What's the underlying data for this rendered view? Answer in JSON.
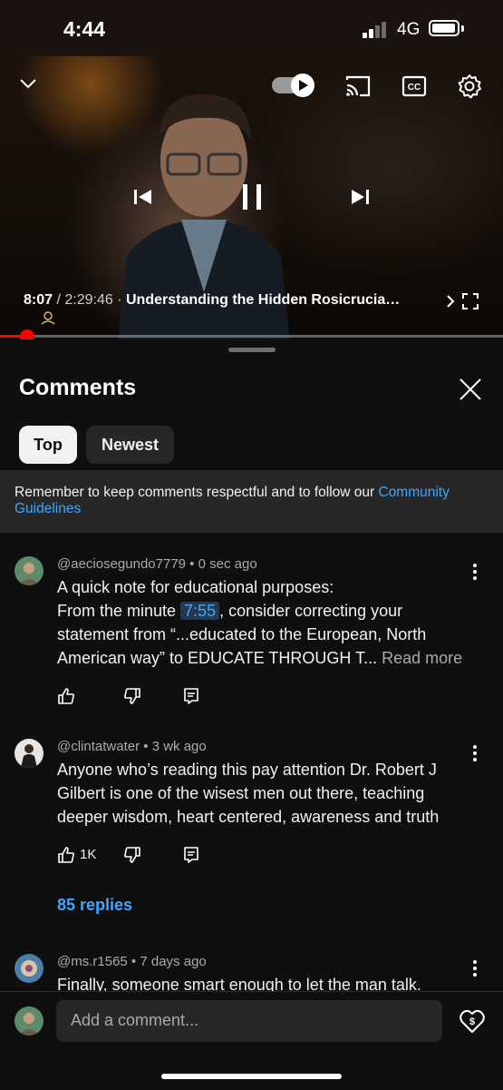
{
  "status_bar": {
    "time": "4:44",
    "network": "4G"
  },
  "video": {
    "current_time": "8:07",
    "duration": "2:29:46",
    "separator": " / ",
    "dot": " · ",
    "title": "Understanding the Hidden Rosicrucia…",
    "progress_fraction": 0.054
  },
  "comments_panel": {
    "title": "Comments",
    "tabs": [
      {
        "label": "Top",
        "selected": true
      },
      {
        "label": "Newest",
        "selected": false
      }
    ],
    "notice_text": "Remember to keep comments respectful and to follow our ",
    "notice_link": "Community Guidelines"
  },
  "comments": [
    {
      "author": "@aeciosegundo7779",
      "age": "0 sec ago",
      "line1": "A quick note for educational purposes:",
      "line2_pre": "From the minute ",
      "timestamp": "7:55",
      "line2_post": ", consider correcting your",
      "line3": "statement from “...educated to the European, North",
      "line4": "American way” to EDUCATE THROUGH T... ",
      "read_more": "Read more"
    },
    {
      "author": "@clintatwater",
      "age": "3 wk ago",
      "line1": "Anyone who’s reading this pay attention Dr. Robert J",
      "line2": "Gilbert is one of the wisest men out there, teaching",
      "line3": "deeper wisdom, heart centered, awareness and truth",
      "likes": "1K",
      "replies": "85 replies"
    },
    {
      "author": "@ms.r1565",
      "age": "7 days ago",
      "line1": "Finally, someone smart enough to let the man talk."
    }
  ],
  "composer": {
    "placeholder": "Add a comment..."
  },
  "colors": {
    "accent_link": "#3ea6ff",
    "progress": "#ff0000",
    "background": "#0f0f0f"
  }
}
